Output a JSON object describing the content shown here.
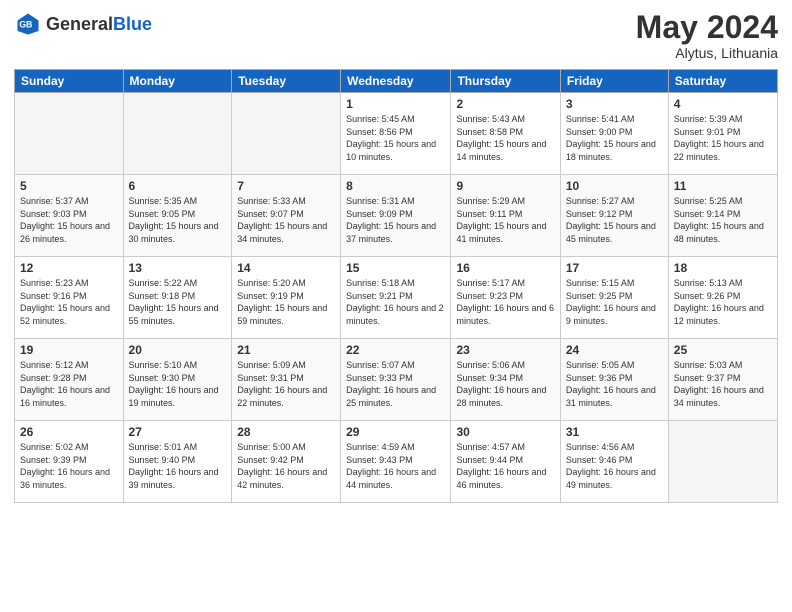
{
  "header": {
    "logo_general": "General",
    "logo_blue": "Blue",
    "main_title": "May 2024",
    "subtitle": "Alytus, Lithuania"
  },
  "weekdays": [
    "Sunday",
    "Monday",
    "Tuesday",
    "Wednesday",
    "Thursday",
    "Friday",
    "Saturday"
  ],
  "weeks": [
    [
      {
        "day": "",
        "empty": true
      },
      {
        "day": "",
        "empty": true
      },
      {
        "day": "",
        "empty": true
      },
      {
        "day": "1",
        "sunrise": "5:45 AM",
        "sunset": "8:56 PM",
        "daylight": "15 hours and 10 minutes."
      },
      {
        "day": "2",
        "sunrise": "5:43 AM",
        "sunset": "8:58 PM",
        "daylight": "15 hours and 14 minutes."
      },
      {
        "day": "3",
        "sunrise": "5:41 AM",
        "sunset": "9:00 PM",
        "daylight": "15 hours and 18 minutes."
      },
      {
        "day": "4",
        "sunrise": "5:39 AM",
        "sunset": "9:01 PM",
        "daylight": "15 hours and 22 minutes."
      }
    ],
    [
      {
        "day": "5",
        "sunrise": "5:37 AM",
        "sunset": "9:03 PM",
        "daylight": "15 hours and 26 minutes."
      },
      {
        "day": "6",
        "sunrise": "5:35 AM",
        "sunset": "9:05 PM",
        "daylight": "15 hours and 30 minutes."
      },
      {
        "day": "7",
        "sunrise": "5:33 AM",
        "sunset": "9:07 PM",
        "daylight": "15 hours and 34 minutes."
      },
      {
        "day": "8",
        "sunrise": "5:31 AM",
        "sunset": "9:09 PM",
        "daylight": "15 hours and 37 minutes."
      },
      {
        "day": "9",
        "sunrise": "5:29 AM",
        "sunset": "9:11 PM",
        "daylight": "15 hours and 41 minutes."
      },
      {
        "day": "10",
        "sunrise": "5:27 AM",
        "sunset": "9:12 PM",
        "daylight": "15 hours and 45 minutes."
      },
      {
        "day": "11",
        "sunrise": "5:25 AM",
        "sunset": "9:14 PM",
        "daylight": "15 hours and 48 minutes."
      }
    ],
    [
      {
        "day": "12",
        "sunrise": "5:23 AM",
        "sunset": "9:16 PM",
        "daylight": "15 hours and 52 minutes."
      },
      {
        "day": "13",
        "sunrise": "5:22 AM",
        "sunset": "9:18 PM",
        "daylight": "15 hours and 55 minutes."
      },
      {
        "day": "14",
        "sunrise": "5:20 AM",
        "sunset": "9:19 PM",
        "daylight": "15 hours and 59 minutes."
      },
      {
        "day": "15",
        "sunrise": "5:18 AM",
        "sunset": "9:21 PM",
        "daylight": "16 hours and 2 minutes."
      },
      {
        "day": "16",
        "sunrise": "5:17 AM",
        "sunset": "9:23 PM",
        "daylight": "16 hours and 6 minutes."
      },
      {
        "day": "17",
        "sunrise": "5:15 AM",
        "sunset": "9:25 PM",
        "daylight": "16 hours and 9 minutes."
      },
      {
        "day": "18",
        "sunrise": "5:13 AM",
        "sunset": "9:26 PM",
        "daylight": "16 hours and 12 minutes."
      }
    ],
    [
      {
        "day": "19",
        "sunrise": "5:12 AM",
        "sunset": "9:28 PM",
        "daylight": "16 hours and 16 minutes."
      },
      {
        "day": "20",
        "sunrise": "5:10 AM",
        "sunset": "9:30 PM",
        "daylight": "16 hours and 19 minutes."
      },
      {
        "day": "21",
        "sunrise": "5:09 AM",
        "sunset": "9:31 PM",
        "daylight": "16 hours and 22 minutes."
      },
      {
        "day": "22",
        "sunrise": "5:07 AM",
        "sunset": "9:33 PM",
        "daylight": "16 hours and 25 minutes."
      },
      {
        "day": "23",
        "sunrise": "5:06 AM",
        "sunset": "9:34 PM",
        "daylight": "16 hours and 28 minutes."
      },
      {
        "day": "24",
        "sunrise": "5:05 AM",
        "sunset": "9:36 PM",
        "daylight": "16 hours and 31 minutes."
      },
      {
        "day": "25",
        "sunrise": "5:03 AM",
        "sunset": "9:37 PM",
        "daylight": "16 hours and 34 minutes."
      }
    ],
    [
      {
        "day": "26",
        "sunrise": "5:02 AM",
        "sunset": "9:39 PM",
        "daylight": "16 hours and 36 minutes."
      },
      {
        "day": "27",
        "sunrise": "5:01 AM",
        "sunset": "9:40 PM",
        "daylight": "16 hours and 39 minutes."
      },
      {
        "day": "28",
        "sunrise": "5:00 AM",
        "sunset": "9:42 PM",
        "daylight": "16 hours and 42 minutes."
      },
      {
        "day": "29",
        "sunrise": "4:59 AM",
        "sunset": "9:43 PM",
        "daylight": "16 hours and 44 minutes."
      },
      {
        "day": "30",
        "sunrise": "4:57 AM",
        "sunset": "9:44 PM",
        "daylight": "16 hours and 46 minutes."
      },
      {
        "day": "31",
        "sunrise": "4:56 AM",
        "sunset": "9:46 PM",
        "daylight": "16 hours and 49 minutes."
      },
      {
        "day": "",
        "empty": true
      }
    ]
  ],
  "colors": {
    "header_bg": "#1565c0",
    "header_text": "#ffffff",
    "row_even_bg": "#f9f9f9",
    "empty_bg": "#f5f5f5"
  }
}
